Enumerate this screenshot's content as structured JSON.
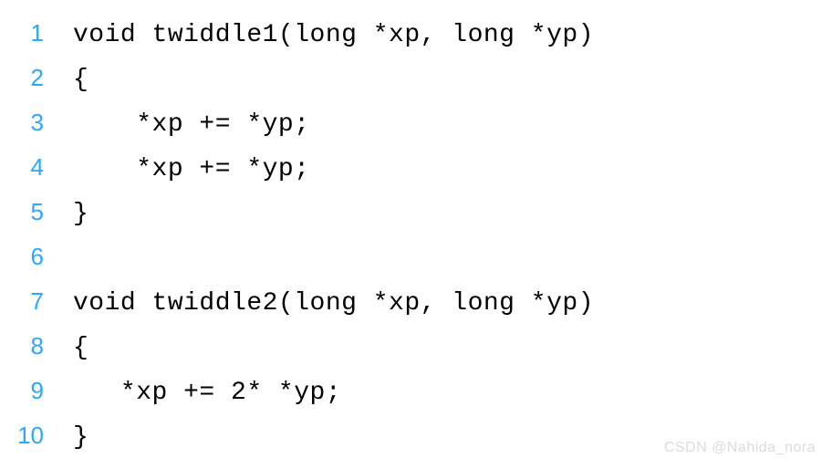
{
  "code": {
    "lines": [
      {
        "num": "1",
        "text": "void twiddle1(long *xp, long *yp)"
      },
      {
        "num": "2",
        "text": "{"
      },
      {
        "num": "3",
        "text": "    *xp += *yp;"
      },
      {
        "num": "4",
        "text": "    *xp += *yp;"
      },
      {
        "num": "5",
        "text": "}"
      },
      {
        "num": "6",
        "text": ""
      },
      {
        "num": "7",
        "text": "void twiddle2(long *xp, long *yp)"
      },
      {
        "num": "8",
        "text": "{"
      },
      {
        "num": "9",
        "text": "   *xp += 2* *yp;"
      },
      {
        "num": "10",
        "text": "}"
      }
    ]
  },
  "watermark": "CSDN @Nahida_nora"
}
